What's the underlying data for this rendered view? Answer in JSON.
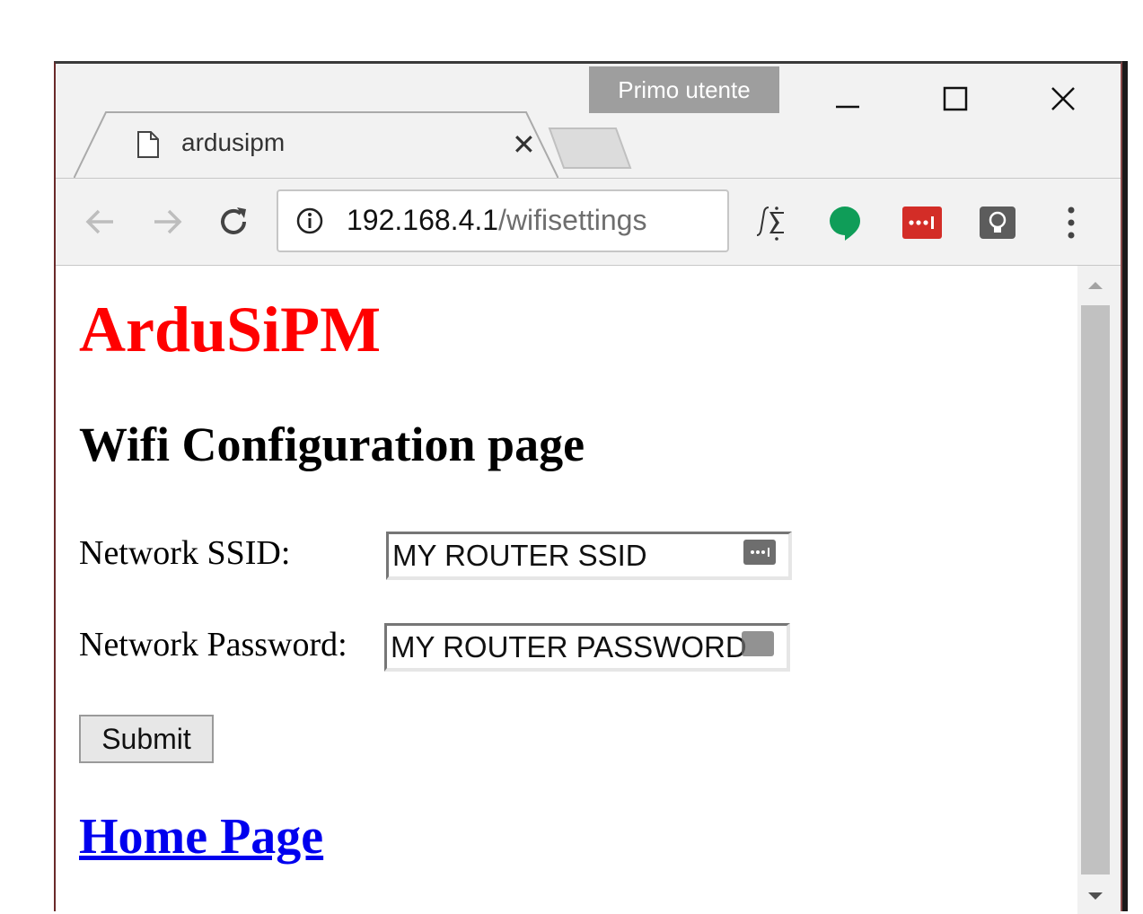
{
  "window": {
    "profile_label": "Primo utente",
    "controls": [
      "minimize",
      "maximize",
      "close"
    ]
  },
  "tab": {
    "title": "ardusipm",
    "close_glyph": "✕",
    "icon": "page-icon"
  },
  "toolbar": {
    "url_host": "192.168.4.1",
    "url_path": "/wifisettings",
    "extensions": [
      "formula-icon",
      "hangouts-icon",
      "lastpass-icon",
      "bulb-icon",
      "menu-icon"
    ]
  },
  "page": {
    "title": "ArduSiPM",
    "subtitle": "Wifi Configuration page",
    "ssid_label": "Network SSID:",
    "ssid_value": "MY ROUTER SSID",
    "password_label": "Network Password:",
    "password_value": "MY ROUTER PASSWORD",
    "submit_label": "Submit",
    "home_link": "Home Page"
  },
  "colors": {
    "title_red": "#ff0000",
    "link_blue": "#0000ee",
    "lastpass_red": "#d32d27",
    "hangouts_green": "#0f9d58"
  }
}
